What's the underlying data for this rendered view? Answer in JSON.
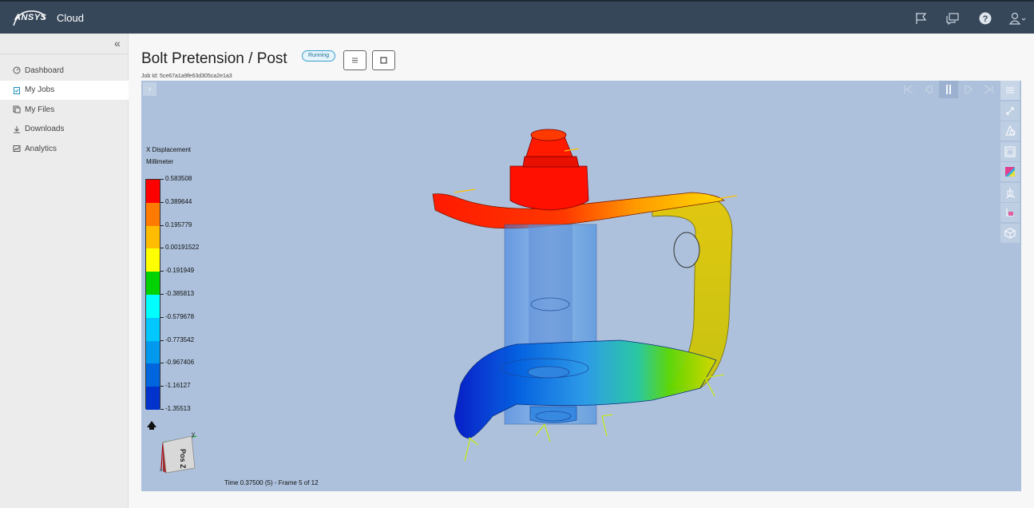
{
  "header": {
    "brand": "Cloud",
    "logo_text": "ANSYS",
    "icons": [
      "flag-icon",
      "chat-icon",
      "help-icon",
      "user-icon"
    ]
  },
  "sidebar": {
    "collapse_glyph": "«",
    "items": [
      {
        "label": "Dashboard",
        "icon": "dashboard-icon"
      },
      {
        "label": "My Jobs",
        "icon": "jobs-icon",
        "active": true
      },
      {
        "label": "My Files",
        "icon": "files-icon"
      },
      {
        "label": "Downloads",
        "icon": "download-icon"
      },
      {
        "label": "Analytics",
        "icon": "analytics-icon"
      }
    ]
  },
  "job": {
    "title": "Bolt Pretension / Post",
    "status": "Running",
    "job_id_label": "Job Id: 5ce67a1a9fe63d305ca2e1a3"
  },
  "viewer": {
    "legend": {
      "title_line1": "X Displacement",
      "title_line2": "Millimeter",
      "values": [
        "0.583508",
        "0.389644",
        "0.195779",
        "0.00191522",
        "-0.191949",
        "-0.385813",
        "-0.579678",
        "-0.773542",
        "-0.967406",
        "-1.16127",
        "-1.35513"
      ],
      "colors": [
        "#ff0000",
        "#ff7a00",
        "#ffbc00",
        "#ffff00",
        "#00d100",
        "#00ffff",
        "#00c8ff",
        "#0099ee",
        "#0066dd",
        "#0033cc",
        "#0000c8"
      ]
    },
    "axis": {
      "label": "Pos Z",
      "y": "y",
      "x": "x"
    },
    "timeline": "Time 0.37500 (5) - Frame 5 of 12",
    "expand_glyph": "›",
    "colors": {
      "background": "#adc1dc",
      "accent": "#36475a"
    }
  }
}
